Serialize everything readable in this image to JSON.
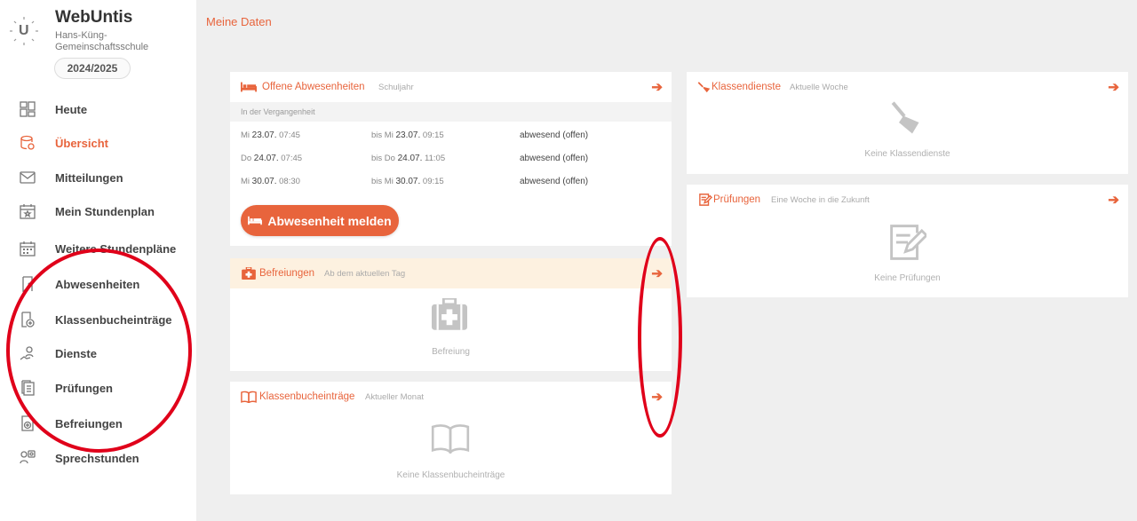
{
  "app": {
    "brand": "WebUntis",
    "school": "Hans-Küng-Gemeinschaftsschule",
    "school_year": "2024/2025",
    "logo_letter": "U"
  },
  "sidebar": {
    "items": [
      {
        "label": "Heute",
        "icon": "dashboard-icon",
        "active": false
      },
      {
        "label": "Übersicht",
        "icon": "overview-icon",
        "active": true
      },
      {
        "label": "Mitteilungen",
        "icon": "envelope-icon",
        "active": false
      },
      {
        "label": "Mein Stundenplan",
        "icon": "calendar-star-icon",
        "active": false
      },
      {
        "label": "Weitere Stundenpläne",
        "icon": "calendar-grid-icon",
        "active": false
      },
      {
        "label": "Abwesenheiten",
        "icon": "absence-icon",
        "active": false
      },
      {
        "label": "Klassenbucheinträge",
        "icon": "class-register-icon",
        "active": false
      },
      {
        "label": "Dienste",
        "icon": "duties-icon",
        "active": false
      },
      {
        "label": "Prüfungen",
        "icon": "exams-icon",
        "active": false
      },
      {
        "label": "Befreiungen",
        "icon": "exemptions-icon",
        "active": false
      },
      {
        "label": "Sprechstunden",
        "icon": "consultation-icon",
        "active": false
      }
    ]
  },
  "main": {
    "page_title": "Meine Daten",
    "absences": {
      "title": "Offene Abwesenheiten",
      "subtitle": "Schuljahr",
      "section_label": "In der Vergangenheit",
      "rows": [
        {
          "from_day": "Mi",
          "from_date": "23.07.",
          "from_time": "07:45",
          "to_day": "bis Mi",
          "to_date": "23.07.",
          "to_time": "09:15",
          "status": "abwesend (offen)"
        },
        {
          "from_day": "Do",
          "from_date": "24.07.",
          "from_time": "07:45",
          "to_day": "bis Do",
          "to_date": "24.07.",
          "to_time": "11:05",
          "status": "abwesend (offen)"
        },
        {
          "from_day": "Mi",
          "from_date": "30.07.",
          "from_time": "08:30",
          "to_day": "bis Mi",
          "to_date": "30.07.",
          "to_time": "09:15",
          "status": "abwesend (offen)"
        }
      ],
      "report_button": "Abwesenheit melden"
    },
    "exemptions": {
      "title": "Befreiungen",
      "subtitle": "Ab dem aktuellen Tag",
      "empty": "Befreiung"
    },
    "class_register": {
      "title": "Klassenbucheinträge",
      "subtitle": "Aktueller Monat",
      "empty": "Keine Klassenbucheinträge"
    },
    "class_duties": {
      "title": "Klassendienste",
      "subtitle": "Aktuelle Woche",
      "empty": "Keine Klassendienste"
    },
    "exams": {
      "title": "Prüfungen",
      "subtitle": "Eine Woche in die Zukunft",
      "empty": "Keine Prüfungen"
    }
  },
  "colors": {
    "accent": "#e8643c",
    "annotation": "#e0001a",
    "exemptions_header_bg": "#fdf1e0"
  }
}
